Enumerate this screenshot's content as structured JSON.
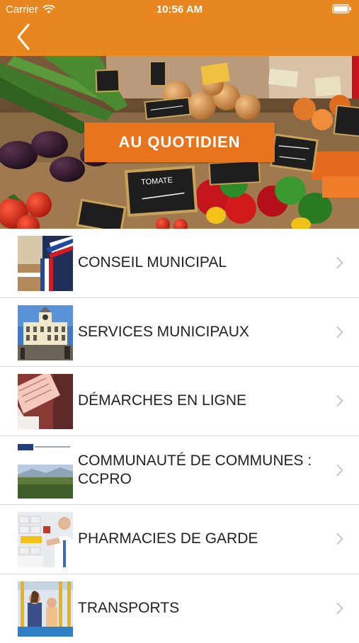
{
  "status": {
    "carrier": "Carrier",
    "time": "10:56 AM"
  },
  "colors": {
    "brand_orange": "#E8861F",
    "button_orange": "#E8741E",
    "text": "#222222",
    "chevron": "#c7c7cc"
  },
  "nav": {
    "back_icon": "chevron-left-icon"
  },
  "hero": {
    "button_label": "AU QUOTIDIEN",
    "sign_label": "TOMATE"
  },
  "menu": {
    "items": [
      {
        "label": "CONSEIL MUNICIPAL",
        "icon": "council-thumbnail"
      },
      {
        "label": "SERVICES MUNICIPAUX",
        "icon": "town-hall-thumbnail"
      },
      {
        "label": "DÉMARCHES EN LIGNE",
        "icon": "documents-thumbnail"
      },
      {
        "label": "COMMUNAUTÉ DE COMMUNES : CCPRO",
        "icon": "ccpro-thumbnail"
      },
      {
        "label": "PHARMACIES DE GARDE",
        "icon": "pharmacy-thumbnail"
      },
      {
        "label": "TRANSPORTS",
        "icon": "transport-thumbnail"
      }
    ]
  }
}
